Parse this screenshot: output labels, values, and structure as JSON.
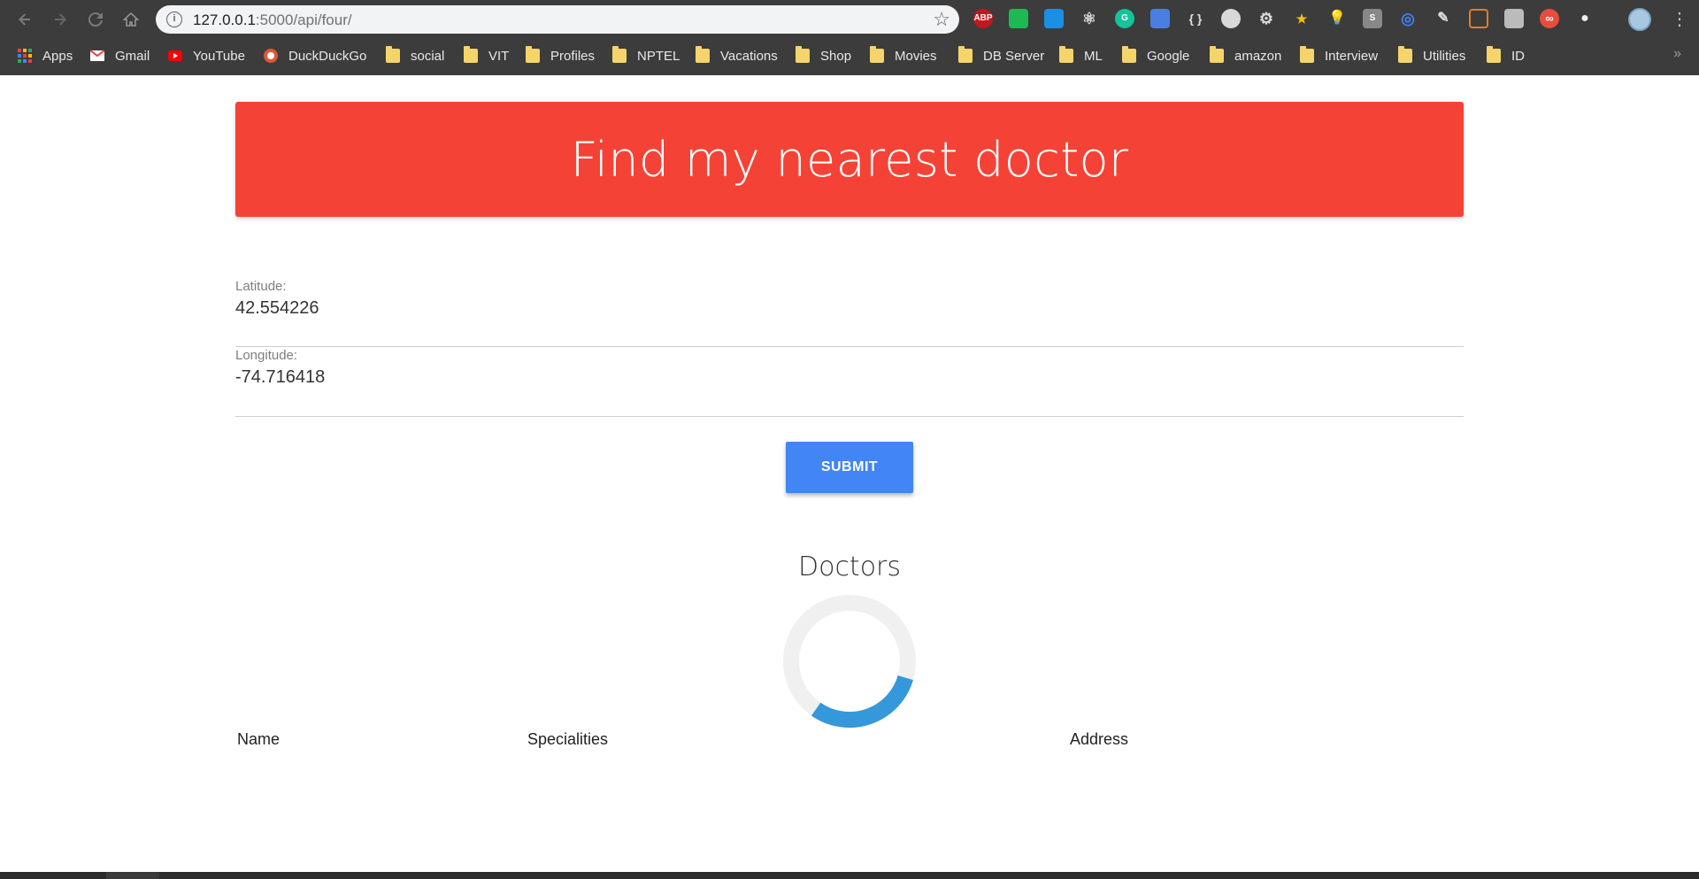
{
  "browser": {
    "url_host": "127.0.0.1",
    "url_rest": ":5000/api/four/",
    "extensions": [
      "ABP",
      "G",
      "{ }",
      "S",
      "∞"
    ],
    "bookmarks": [
      {
        "label": "Apps",
        "icon": "apps-grid-icon"
      },
      {
        "label": "Gmail",
        "icon": "gmail-icon"
      },
      {
        "label": "YouTube",
        "icon": "youtube-icon"
      },
      {
        "label": "DuckDuckGo",
        "icon": "duckduckgo-icon"
      },
      {
        "label": "social",
        "icon": "folder-icon"
      },
      {
        "label": "VIT",
        "icon": "folder-icon"
      },
      {
        "label": "Profiles",
        "icon": "folder-icon"
      },
      {
        "label": "NPTEL",
        "icon": "folder-icon"
      },
      {
        "label": "Vacations",
        "icon": "folder-icon"
      },
      {
        "label": "Shop",
        "icon": "folder-icon"
      },
      {
        "label": "Movies",
        "icon": "folder-icon"
      },
      {
        "label": "DB Server",
        "icon": "folder-icon"
      },
      {
        "label": "ML",
        "icon": "folder-icon"
      },
      {
        "label": "Google",
        "icon": "folder-icon"
      },
      {
        "label": "amazon",
        "icon": "folder-icon"
      },
      {
        "label": "Interview",
        "icon": "folder-icon"
      },
      {
        "label": "Utilities",
        "icon": "folder-icon"
      },
      {
        "label": "ID",
        "icon": "folder-icon"
      }
    ],
    "overflow": "»"
  },
  "header": {
    "title": "Find my nearest doctor"
  },
  "form": {
    "latitude_label": "Latitude:",
    "latitude_value": "42.554226",
    "longitude_label": "Longitude:",
    "longitude_value": "-74.716418",
    "submit_label": "SUBMIT"
  },
  "results": {
    "title": "Doctors",
    "columns": [
      "Name",
      "Specialities",
      "Address"
    ],
    "loading": true
  },
  "colors": {
    "banner": "#f44336",
    "button": "#4285f4",
    "spinner_track": "#f0f0f0",
    "spinner_arc": "#3498db"
  }
}
